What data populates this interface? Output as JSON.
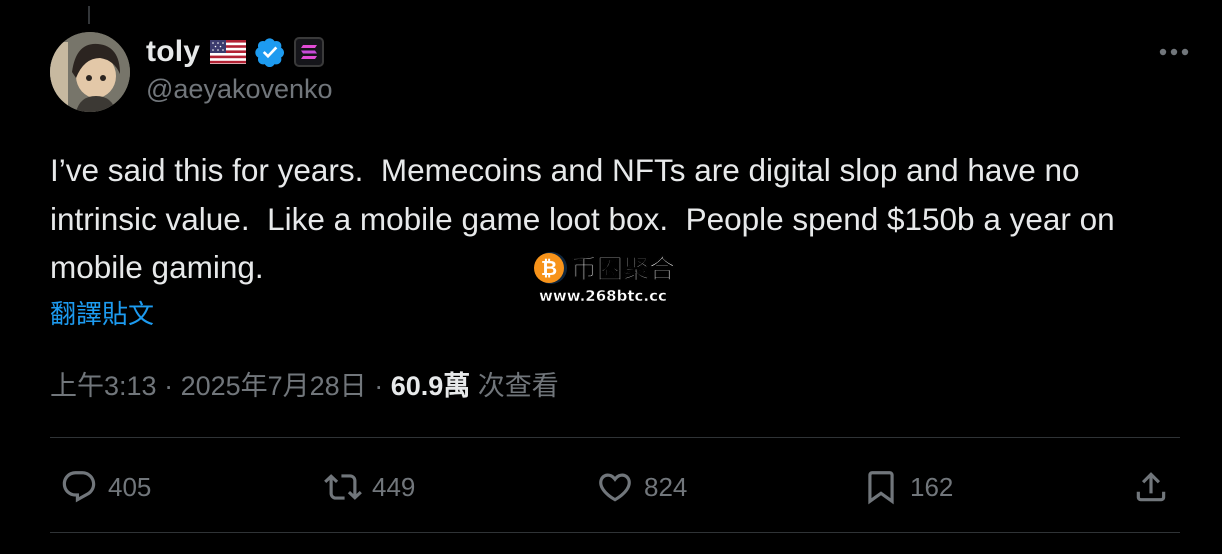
{
  "author": {
    "name": "toly",
    "handle": "@aeyakovenko",
    "flag_icon": "us-flag-icon",
    "verified_icon": "verified-badge-icon",
    "affiliate_icon": "solana-logo-icon"
  },
  "tweet": {
    "text": "I’ve said this for years.  Memecoins and NFTs are digital slop and have no intrinsic value.  Like a mobile game loot box.  People spend $150b a year on mobile gaming.",
    "translate_label": "翻譯貼文"
  },
  "meta": {
    "time": "上午3:13",
    "sep1": " · ",
    "date": "2025年7月28日",
    "sep2": " · ",
    "views": "60.9萬",
    "views_label": " 次查看"
  },
  "watermark": {
    "title": "币圈聚合",
    "url": "www.268btc.cc"
  },
  "actions": {
    "replies": "405",
    "reposts": "449",
    "likes": "824",
    "bookmarks": "162"
  },
  "colors": {
    "background": "#000000",
    "text": "#e7e9ea",
    "secondary": "#71767b",
    "link": "#1d9bf0",
    "divider": "#2f3336"
  }
}
